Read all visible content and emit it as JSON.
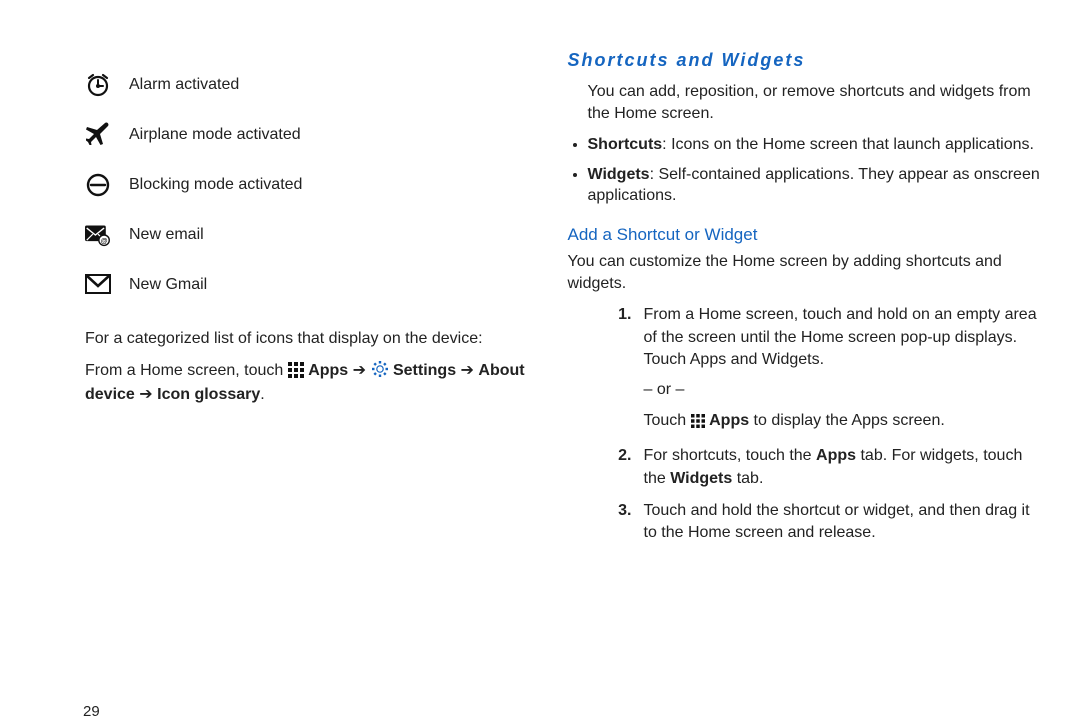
{
  "left": {
    "icons": [
      {
        "name": "alarm-icon",
        "label": "Alarm activated"
      },
      {
        "name": "airplane-icon",
        "label": "Airplane mode activated"
      },
      {
        "name": "blocking-icon",
        "label": "Blocking mode activated"
      },
      {
        "name": "email-icon",
        "label": "New email"
      },
      {
        "name": "gmail-icon",
        "label": "New Gmail"
      }
    ],
    "intro": "For a categorized list of icons that display on the device:",
    "nav_prefix": "From a Home screen, touch",
    "apps_word": "Apps",
    "arrow": "➔",
    "settings_word": "Settings",
    "about_device": "About device",
    "icon_glossary": "Icon glossary"
  },
  "right": {
    "title": "Shortcuts and Widgets",
    "intro": "You can add, reposition, or remove shortcuts and widgets from the Home screen.",
    "bullet1_b": "Shortcuts",
    "bullet1_rest": ": Icons on the Home screen that launch applications.",
    "bullet2_b": "Widgets",
    "bullet2_rest": ": Self-contained applications. They appear as onscreen applications.",
    "sub_title": "Add a Shortcut or Widget",
    "sub_intro": "You can customize the Home screen by adding shortcuts and widgets.",
    "step1": "From a Home screen, touch and hold on an empty area of the screen until the Home screen pop-up displays. Touch Apps and Widgets.",
    "or": "– or –",
    "step1b_pre": "Touch",
    "step1b_apps": "Apps",
    "step1b_post": " to display the Apps screen.",
    "step2_pre": "For shortcuts, touch the ",
    "step2_b1": "Apps",
    "step2_mid": " tab. For widgets, touch the ",
    "step2_b2": "Widgets",
    "step2_post": " tab.",
    "step3": "Touch and hold the shortcut or widget, and then drag it to the Home screen and release."
  },
  "page_number": "29"
}
